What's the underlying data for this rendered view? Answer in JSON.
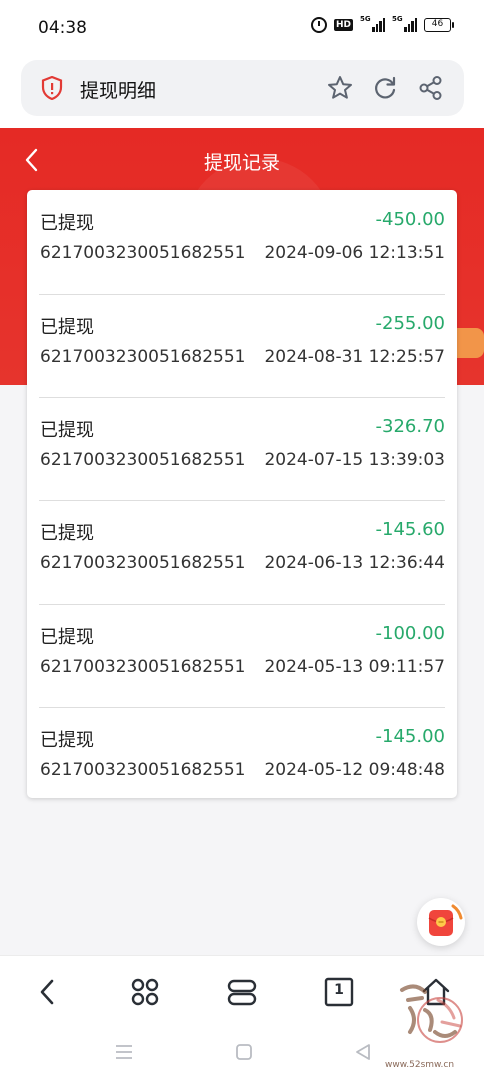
{
  "status_bar": {
    "time": "04:38",
    "network_label_1": "5G",
    "network_label_2": "5G",
    "hd_label": "HD",
    "battery": "46"
  },
  "browser": {
    "title": "提现明细",
    "icons": [
      "shield-alert-icon",
      "star-icon",
      "refresh-icon",
      "share-icon"
    ]
  },
  "page": {
    "title": "提现记录",
    "accent_color": "#e52a25",
    "amount_color": "#27a96b"
  },
  "records": [
    {
      "status": "已提现",
      "amount": "-450.00",
      "account": "6217003230051682551",
      "time": "2024-09-06 12:13:51"
    },
    {
      "status": "已提现",
      "amount": "-255.00",
      "account": "6217003230051682551",
      "time": "2024-08-31 12:25:57"
    },
    {
      "status": "已提现",
      "amount": "-326.70",
      "account": "6217003230051682551",
      "time": "2024-07-15 13:39:03"
    },
    {
      "status": "已提现",
      "amount": "-145.60",
      "account": "6217003230051682551",
      "time": "2024-06-13 12:36:44"
    },
    {
      "status": "已提现",
      "amount": "-100.00",
      "account": "6217003230051682551",
      "time": "2024-05-13 09:11:57"
    },
    {
      "status": "已提现",
      "amount": "-145.00",
      "account": "6217003230051682551",
      "time": "2024-05-12 09:48:48"
    }
  ],
  "toolbar": {
    "tab_count": "1",
    "icons": [
      "back-arrow-icon",
      "apps-icon",
      "tabs-switch-icon",
      "tab-count-icon",
      "home-icon"
    ]
  },
  "system_nav": {
    "icons": [
      "menu-icon",
      "square-home-icon",
      "triangle-back-icon"
    ]
  },
  "watermark": {
    "text": "www.52smw.cn"
  }
}
